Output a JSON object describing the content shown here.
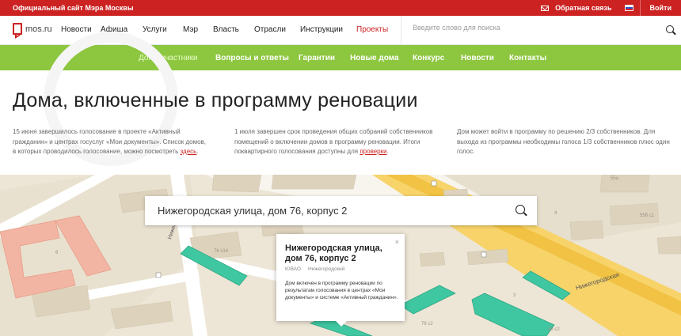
{
  "topbar": {
    "official": "Официальный сайт Мэра Москвы",
    "feedback": "Обратная связь",
    "login": "Войти"
  },
  "logo": {
    "text": "mos.ru"
  },
  "nav": {
    "items": [
      "Новости",
      "Афиша",
      "Услуги",
      "Мэр",
      "Власть",
      "Отрасли",
      "Инструкции",
      "Проекты"
    ],
    "search_placeholder": "Введите слово для поиска"
  },
  "subnav": {
    "items": [
      "Дома-участники",
      "Вопросы и ответы",
      "Гарантии",
      "Новые дома",
      "Конкурс",
      "Новости",
      "Контакты"
    ]
  },
  "page": {
    "title": "Дома, включенные в программу реновации",
    "col1": "15 июня завершилось голосование в проекте «Активный гражданин» и центрах госуслуг «Мои документы». Список домов, в которых проводилось голосование, можно посмотреть",
    "col1_link": "здесь",
    "col2": "1 июля завершен срок проведения общих собраний собственников помещений о включении домов в программу реновации. Итоги поквартирного голосования доступны для",
    "col2_link": "проверки",
    "col3": "Дом может войти в программу по решению 2/3 собственников. Для выхода из программы необходимы голоса 1/3 собственников плюс один голос."
  },
  "map": {
    "search_value": "Нижегородская улица, дом 76, корпус 2",
    "labels": {
      "street1": "Нижегородская",
      "street2": "Нижегородская",
      "b55a": "55а",
      "b55b": "55б с1",
      "b76": "76 с14",
      "b6": "6",
      "b1": "1",
      "b4": "4",
      "b3": "3",
      "b76k": "76 с2",
      "b86": "86 с2"
    },
    "popup": {
      "close": "×",
      "title": "Нижегородская улица, дом 76, корпус 2",
      "district": "ЮВАО",
      "area": "Нижегородский",
      "text": "Дом включен в программу реновации по результатам голосования в центрах «Мои документы» и системе «Активный гражданин»."
    }
  }
}
